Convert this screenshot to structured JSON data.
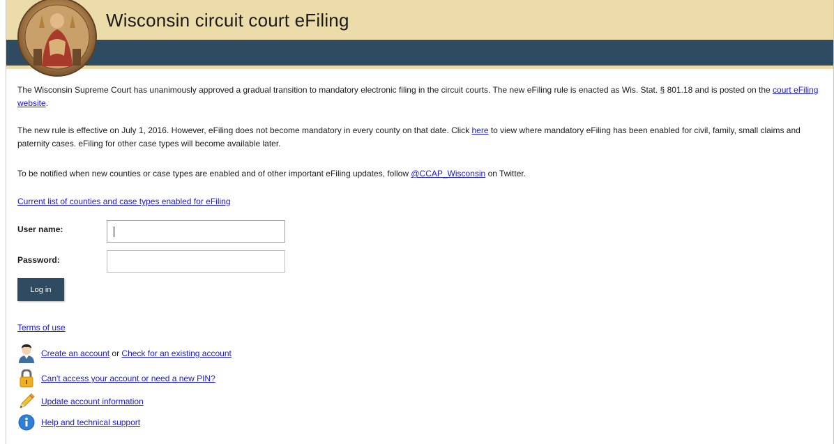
{
  "header": {
    "title": "Wisconsin circuit court eFiling"
  },
  "intro": {
    "p1_text": "The Wisconsin Supreme Court has unanimously approved a gradual transition to mandatory electronic filing in the circuit courts. The new eFiling rule is enacted as Wis. Stat. § 801.18 and is posted on the ",
    "p1_link": "court eFiling website",
    "p1_end": ".",
    "p2_text": "The new rule is effective on July 1, 2016. However, eFiling does not become mandatory in every county on that date. Click ",
    "p2_link": "here",
    "p2_end": " to view where mandatory eFiling has been enabled for civil, family, small claims and paternity cases. eFiling for other case types will become available later.",
    "p3_text": "To be notified when new counties or case types are enabled and of other important eFiling updates, follow ",
    "p3_link": "@CCAP_Wisconsin",
    "p3_end": " on Twitter.",
    "counties_link": "Current list of counties and case types enabled for eFiling"
  },
  "login": {
    "username_label": "User name:",
    "username_value": "",
    "password_label": "Password:",
    "password_value": "",
    "login_button": "Log in"
  },
  "links": {
    "terms": "Terms of use",
    "create_account": "Create an account",
    "or": " or ",
    "check_account": "Check for an existing account",
    "cant_access": "Can't access your account or need a new PIN?",
    "update_account": "Update account information",
    "help": "Help and technical support"
  },
  "icons": {
    "seal": "court-seal-icon",
    "user": "user-icon",
    "lock": "lock-icon",
    "pencil": "pencil-icon",
    "info": "info-icon"
  },
  "colors": {
    "header_tan": "#ecdcaa",
    "header_navy": "#2e4b62",
    "link": "#1a1acc"
  }
}
